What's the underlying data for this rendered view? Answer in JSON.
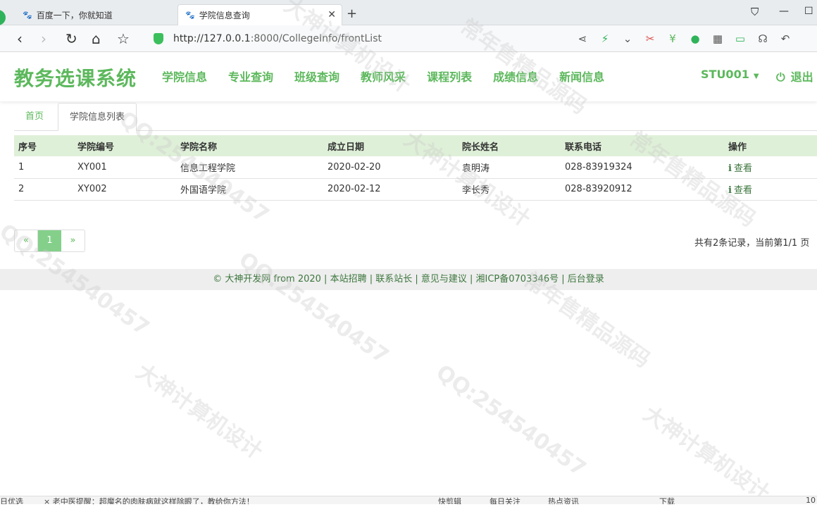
{
  "browser": {
    "tabs": [
      {
        "label": "百度一下，你就知道",
        "icon": "paw-icon"
      },
      {
        "label": "学院信息查询",
        "icon": "paw-icon",
        "active": true
      }
    ],
    "url_prefix": "http://127.0.0.1",
    "url_suffix": ":8000/CollegeInfo/frontList"
  },
  "header": {
    "logo": "教务选课系统",
    "nav": [
      "学院信息",
      "专业查询",
      "班级查询",
      "教师风采",
      "课程列表",
      "成绩信息",
      "新闻信息"
    ],
    "user": "STU001",
    "logout": "退出"
  },
  "breadcrumb": {
    "home": "首页",
    "active": "学院信息列表"
  },
  "table": {
    "columns": [
      "序号",
      "学院编号",
      "学院名称",
      "成立日期",
      "院长姓名",
      "联系电话",
      "操作"
    ],
    "rows": [
      [
        "1",
        "XY001",
        "信息工程学院",
        "2020-02-20",
        "袁明涛",
        "028-83919324",
        "查看"
      ],
      [
        "2",
        "XY002",
        "外国语学院",
        "2020-02-12",
        "李长秀",
        "028-83920912",
        "查看"
      ]
    ]
  },
  "pagination": {
    "prev": "«",
    "current": "1",
    "next": "»",
    "info": "共有2条记录，当前第1/1 页"
  },
  "footer": "© 大神开发网 from 2020 | 本站招聘 | 联系站长 | 意见与建议 | 湘ICP备0703346号 | 后台登录",
  "statusbar": {
    "left": "日优选",
    "news": "× 老中医提醒：超魔名的肉肤病就这样除眼了，教给你方法！",
    "items": [
      "快剪辑",
      "每日关注",
      "热点资讯",
      "下载"
    ],
    "zoom": "10"
  },
  "watermarks": [
    "大神计算机设计",
    "QQ:254540457",
    "常年售精品源码"
  ],
  "colors": {
    "brand_green": "#5cb85c",
    "header_row_bg": "#dff0d8",
    "active_page_bg": "#84d08b",
    "footer_bg": "#eeeeee"
  }
}
